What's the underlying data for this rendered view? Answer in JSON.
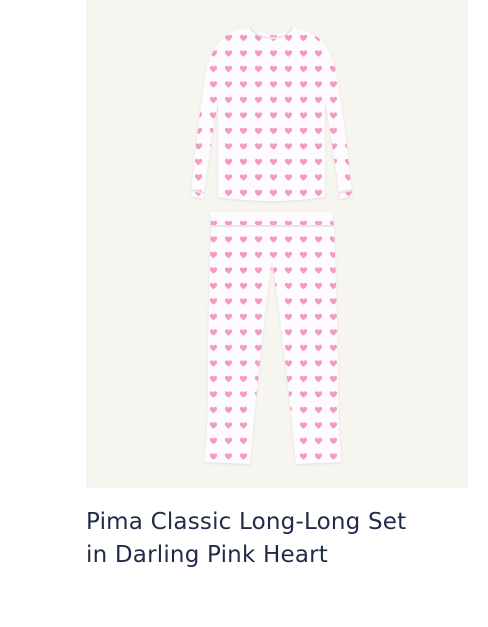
{
  "product": {
    "title_line1": "Pima Classic Long-Long Set",
    "title_line2": "in Darling Pink Heart",
    "image": {
      "top_icon": "long-sleeve-top-icon",
      "pants_icon": "pajama-pants-icon",
      "print_icon": "heart-icon"
    }
  },
  "colors": {
    "image_background": "#f6f5ef",
    "garment": "#fdfbfd",
    "heart": "#f29bc4",
    "title_text": "#1f2b47"
  }
}
